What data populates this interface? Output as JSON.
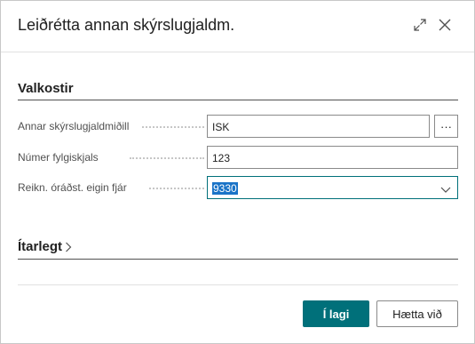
{
  "dialog": {
    "title": "Leiðrétta annan skýrslugjaldm."
  },
  "header_icons": {
    "expand": "expand-icon",
    "close": "close-icon"
  },
  "sections": {
    "valkostir": "Valkostir",
    "itarlegt": "Ítarlegt"
  },
  "fields": [
    {
      "label": "Annar skýrslugjaldmiðill",
      "value": "ISK",
      "control": "text-with-lookup",
      "lookup_label": "···"
    },
    {
      "label": "Númer fylgiskjals",
      "value": "123",
      "control": "text"
    },
    {
      "label": "Reikn. óráðst. eigin fjár",
      "value": "9330",
      "control": "dropdown",
      "selected": true
    }
  ],
  "buttons": {
    "ok": "Í lagi",
    "cancel": "Hætta við"
  },
  "colors": {
    "accent": "#00707a",
    "selection": "#1a73c7",
    "border": "#8a8a8a"
  }
}
